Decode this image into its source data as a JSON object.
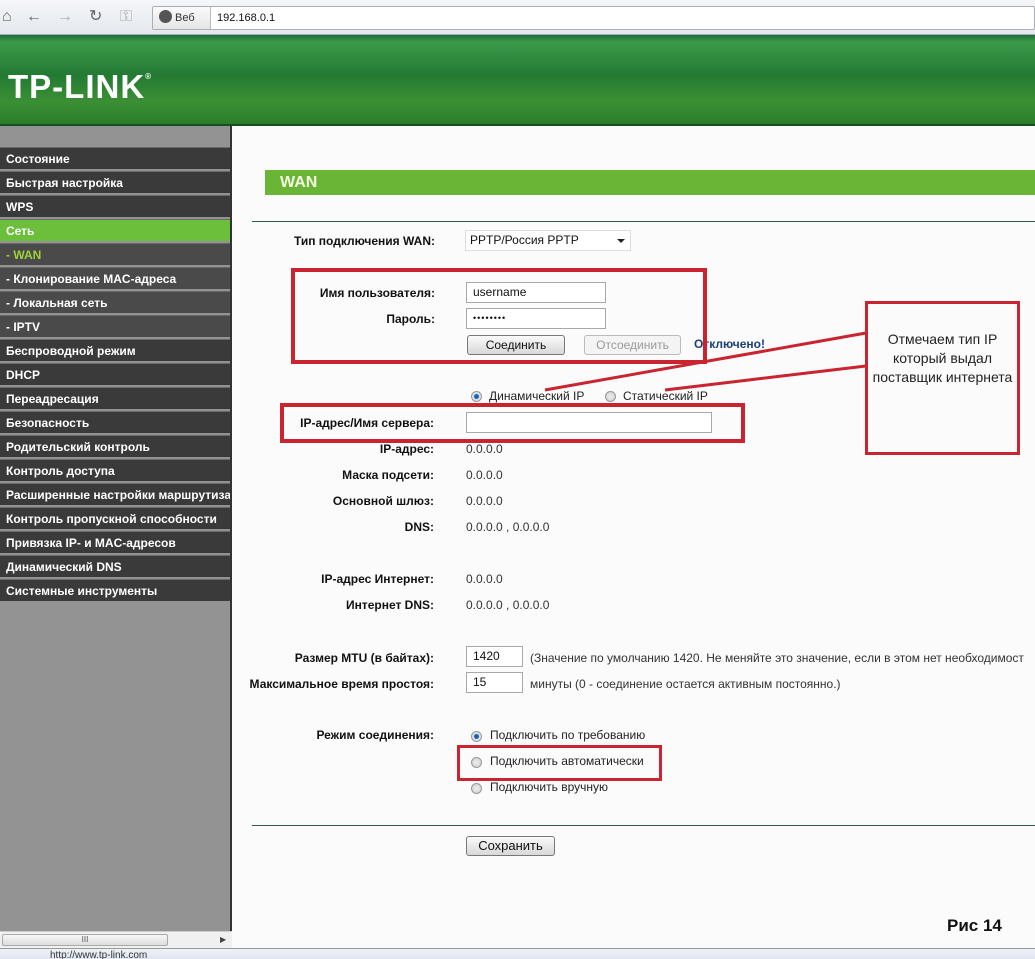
{
  "browser": {
    "back_icon": "←",
    "forward_icon": "→",
    "reload_icon": "↻",
    "key_icon": "⚿",
    "web_label": "Веб",
    "url": "192.168.0.1",
    "status_url": "http://www.tp-link.com"
  },
  "header": {
    "logo": "TP-LINK",
    "logo_mark": "®"
  },
  "sidebar": {
    "items": [
      {
        "label": "Состояние"
      },
      {
        "label": "Быстрая настройка"
      },
      {
        "label": "WPS"
      },
      {
        "label": "Сеть"
      },
      {
        "label": "- WAN"
      },
      {
        "label": "- Клонирование MAC-адреса"
      },
      {
        "label": "- Локальная сеть"
      },
      {
        "label": "- IPTV"
      },
      {
        "label": "Беспроводной режим"
      },
      {
        "label": "DHCP"
      },
      {
        "label": "Переадресация"
      },
      {
        "label": "Безопасность"
      },
      {
        "label": "Родительский контроль"
      },
      {
        "label": "Контроль доступа"
      },
      {
        "label": "Расширенные настройки маршрутизатора"
      },
      {
        "label": "Контроль пропускной способности"
      },
      {
        "label": "Привязка IP- и MAC-адресов"
      },
      {
        "label": "Динамический DNS"
      },
      {
        "label": "Системные инструменты"
      }
    ],
    "scroll_thumb": "III",
    "scroll_arrow": "▶"
  },
  "main": {
    "section_title": "WAN",
    "wan_type": {
      "label": "Тип подключения WAN:",
      "value": "PPTP/Россия PPTP"
    },
    "username": {
      "label": "Имя пользователя:",
      "value": "username"
    },
    "password": {
      "label": "Пароль:",
      "value": "••••••••"
    },
    "connect_button": "Соединить",
    "disconnect_button": "Отсоединить",
    "connection_status": "Отключено!",
    "ip_type": {
      "dynamic": "Динамический IP",
      "static": "Статический IP",
      "selected": "dynamic"
    },
    "server": {
      "label": "IP-адрес/Имя сервера:",
      "value": ""
    },
    "ip_address": {
      "label": "IP-адрес:",
      "value": "0.0.0.0"
    },
    "subnet_mask": {
      "label": "Маска подсети:",
      "value": "0.0.0.0"
    },
    "gateway": {
      "label": "Основной шлюз:",
      "value": "0.0.0.0"
    },
    "dns": {
      "label": "DNS:",
      "value": "0.0.0.0 , 0.0.0.0"
    },
    "internet_ip": {
      "label": "IP-адрес Интернет:",
      "value": "0.0.0.0"
    },
    "internet_dns": {
      "label": "Интернет DNS:",
      "value": "0.0.0.0 , 0.0.0.0"
    },
    "mtu": {
      "label": "Размер MTU (в байтах):",
      "value": "1420",
      "hint": "(Значение по умолчанию 1420. Не меняйте это значение, если в этом нет необходимост"
    },
    "idle": {
      "label": "Максимальное время простоя:",
      "value": "15",
      "hint": "минуты (0 - соединение остается активным постоянно.)"
    },
    "mode": {
      "label": "Режим соединения:",
      "options": [
        "Подключить по требованию",
        "Подключить автоматически",
        "Подключить вручную"
      ],
      "selected": 0
    },
    "save_button": "Сохранить"
  },
  "annotations": {
    "callout": "Отмечаем тип IP который выдал поставщик интернета",
    "figure_label": "Рис 14",
    "accent_color": "#c9242f"
  }
}
